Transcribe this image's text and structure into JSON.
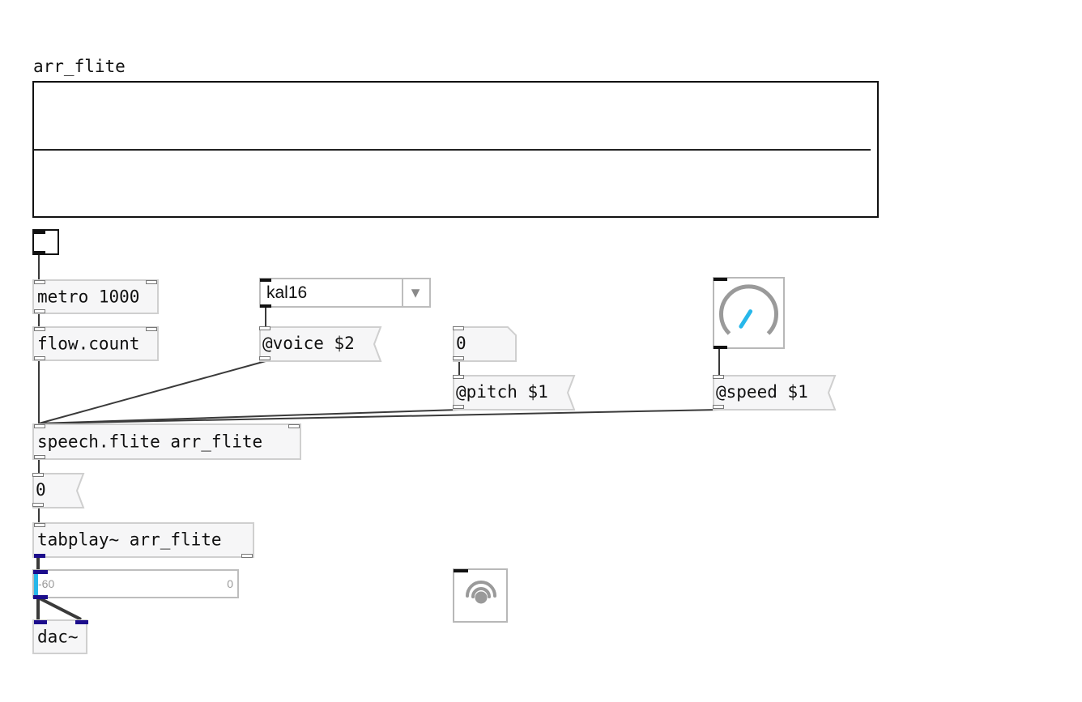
{
  "array": {
    "name": "arr_flite"
  },
  "objects": {
    "metro": "metro 1000",
    "flow_count": "flow.count",
    "speech": "speech.flite arr_flite",
    "tabplay": "tabplay~ arr_flite",
    "dac": "dac~"
  },
  "messages": {
    "voice": "@voice $2",
    "pitch": "@pitch $1",
    "speed": "@speed $1",
    "zero": "0"
  },
  "number_box": {
    "value": "0"
  },
  "voice_menu": {
    "selected": "kal16",
    "arrow_icon": "triangle-down-icon"
  },
  "speed_knob": {
    "level": 0.62,
    "accent": "#27b7ea"
  },
  "level_meter": {
    "min_label": "-60",
    "max_label": "0",
    "level": 0.0
  },
  "icons": {
    "knob": "dial-icon",
    "speaker": "speaker-icon",
    "toggle": "toggle-icon"
  },
  "colors": {
    "wire": "#3a3a3a",
    "signal_port": "#1c0d8c",
    "accent": "#27b7ea"
  }
}
